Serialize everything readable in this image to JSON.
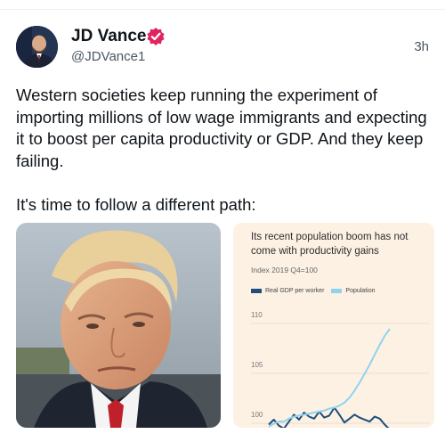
{
  "author": {
    "name": "JD Vance",
    "handle": "@JDVance1",
    "timestamp": "3h",
    "verified_color": "#e0245e"
  },
  "tweet": {
    "paragraphs": [
      "Western societies keep running the experiment of importing millions of low wage immigrants and expecting it to boost per capita productivity or GDP. And they keep failing.",
      "It's time to follow a different path:"
    ]
  },
  "media": {
    "chart": {
      "title": "Its recent population boom has not come with productivity gains",
      "subtitle": "Index 2019 Q4=100",
      "legend": [
        {
          "label": "Real GDP per worker",
          "color": "#1f4f7a"
        },
        {
          "label": "Population",
          "color": "#8fd3ee"
        }
      ],
      "yticks": [
        "110",
        "105",
        "100"
      ]
    }
  },
  "chart_data": {
    "type": "line",
    "title": "Its recent population boom has not come with productivity gains",
    "ylabel": "Index 2019 Q4=100",
    "ylim": [
      99,
      111
    ],
    "series": [
      {
        "name": "Real GDP per worker",
        "color": "#1f4f7a",
        "values": [
          99.6,
          100.1,
          99.5,
          99.2,
          99.9,
          100.6,
          100.1,
          100.8,
          100.4,
          100.2,
          100.9,
          100.3,
          100.5,
          101.3,
          100.6,
          99.8,
          100.2,
          100.6,
          100.3,
          100.1,
          99.9,
          100.4,
          100.2,
          99.6,
          99.1
        ]
      },
      {
        "name": "Population",
        "color": "#8fd3ee",
        "values": [
          99.4,
          99.7,
          99.9,
          99.9,
          100.2,
          100.4,
          100.5,
          100.6,
          100.7,
          100.8,
          100.9,
          101.0,
          101.2,
          101.3,
          101.5,
          101.8,
          102.3,
          103.0,
          103.8,
          104.7,
          105.6,
          106.6,
          107.6,
          108.5,
          109.2
        ]
      }
    ]
  }
}
